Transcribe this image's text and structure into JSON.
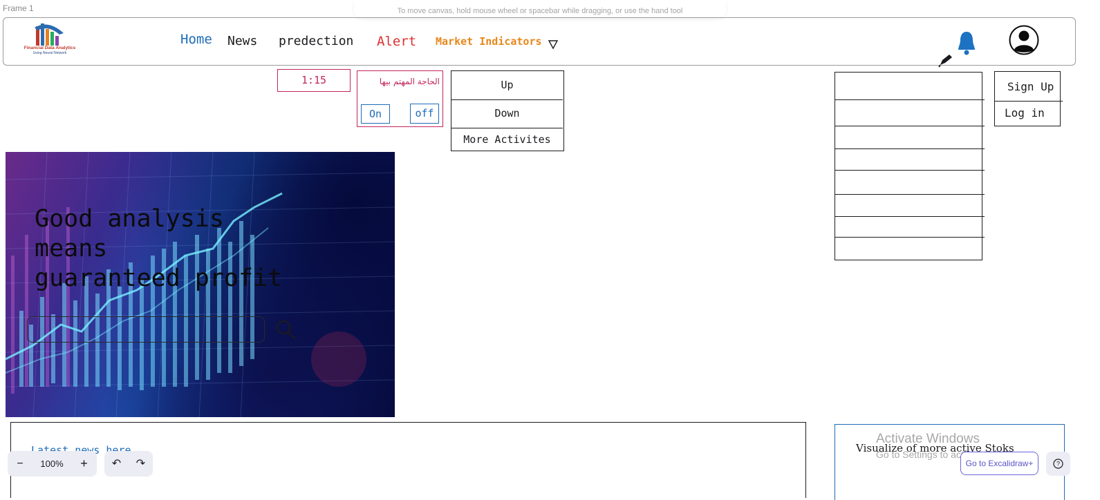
{
  "canvas": {
    "frame_label": "Frame 1",
    "hint": "To move canvas, hold mouse wheel or spacebar while dragging, or use the hand tool"
  },
  "header": {
    "logo": {
      "title": "Financial Data Analytics",
      "subtitle": "Using Neural Network"
    },
    "nav": {
      "home": "Home",
      "news": "News",
      "prediction": "predection",
      "alert": "Alert",
      "market": "Market Indicators"
    }
  },
  "time": "1:15",
  "alert_panel": {
    "title": "الحاجة المهتم بيها",
    "on": "On",
    "off": "off"
  },
  "dropdown": {
    "items": [
      "Up",
      "Down",
      "More Activites"
    ]
  },
  "auth": {
    "sign_up": "Sign Up",
    "log_in": "Log in"
  },
  "hero": {
    "headline": "Good analysis\nmeans\nguaranteed profit",
    "search_placeholder": ""
  },
  "news": {
    "link": "Latest news here"
  },
  "viz": {
    "title": "Visualize of more active Stoks"
  },
  "windows_watermark": {
    "line1": "Activate Windows",
    "line2": "Go to Settings to activate Windows."
  },
  "toolbar": {
    "zoom_out": "−",
    "zoom": "100%",
    "zoom_in": "+",
    "undo": "↶",
    "redo": "↷",
    "go_plus": "Go to Excalidraw+",
    "help": "?"
  },
  "colors": {
    "blue": "#1d6bb8",
    "pink": "#c2255c",
    "red": "#e03131",
    "orange": "#e8871a"
  },
  "icons": [
    "triangle-down-icon",
    "bell-icon",
    "pen-icon",
    "user-avatar-icon",
    "search-icon"
  ]
}
